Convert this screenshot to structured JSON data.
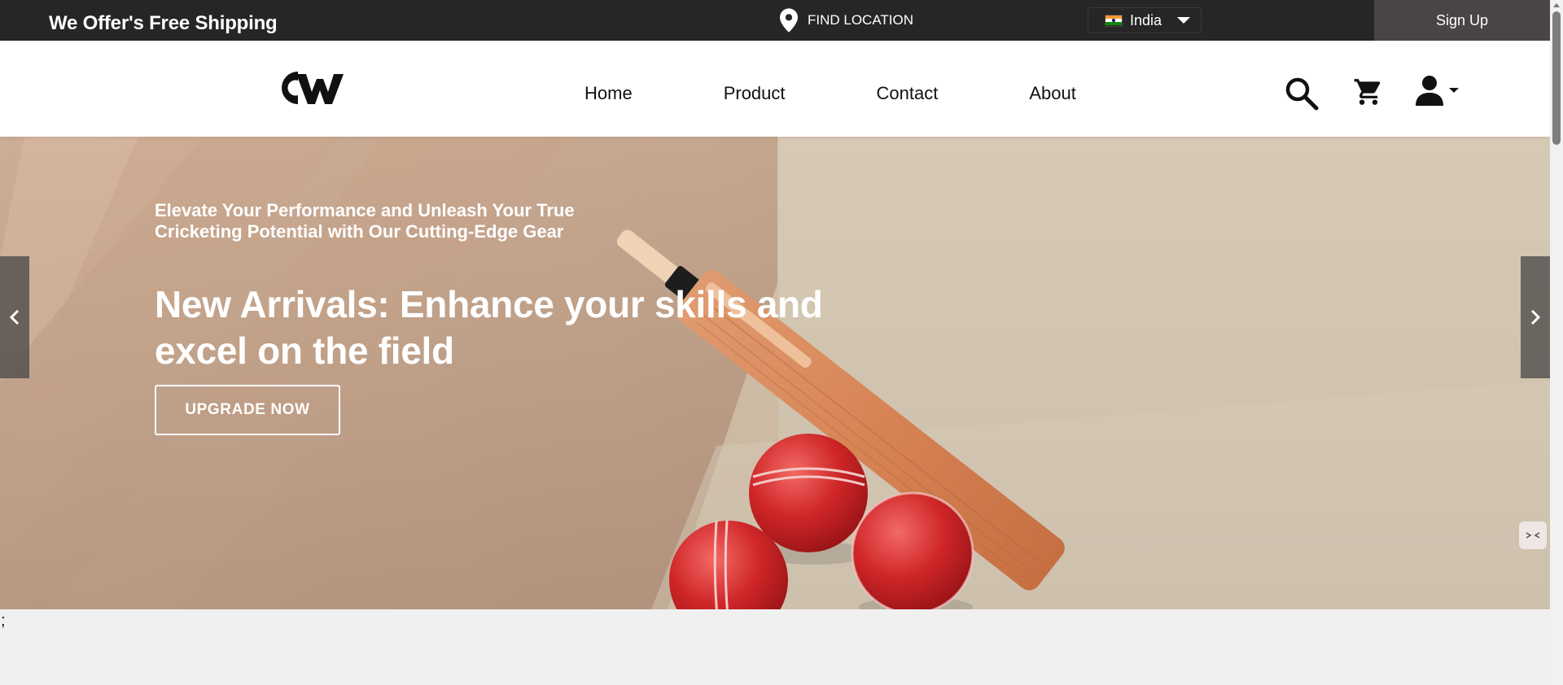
{
  "topbar": {
    "promo": "We Offer's Free Shipping",
    "location_icon": "map-pin-icon",
    "location_label": "FIND LOCATION",
    "country": "India",
    "country_flag": "india-flag-icon",
    "signup_label": "Sign Up"
  },
  "nav": {
    "logo": "cw-logo",
    "links": [
      "Home",
      "Product",
      "Contact",
      "About"
    ],
    "icons": [
      "search-icon",
      "cart-icon",
      "user-icon"
    ]
  },
  "hero": {
    "subtitle": "Elevate Your Performance and Unleash Your True Cricketing Potential with Our Cutting-Edge Gear",
    "title": "New Arrivals: Enhance your skills and excel on the field",
    "cta_label": "UPGRADE NOW",
    "background": "cricket-bat-and-balls-photo",
    "prev_icon": "chevron-left-icon",
    "next_icon": "chevron-right-icon"
  },
  "footer_stray_text": ";",
  "colors": {
    "topbar_bg": "#262626",
    "signup_bg": "#4a4444",
    "nav_bg": "#ffffff",
    "page_bg": "#f1f0f0",
    "hero_bg": "#d3c0a8"
  }
}
